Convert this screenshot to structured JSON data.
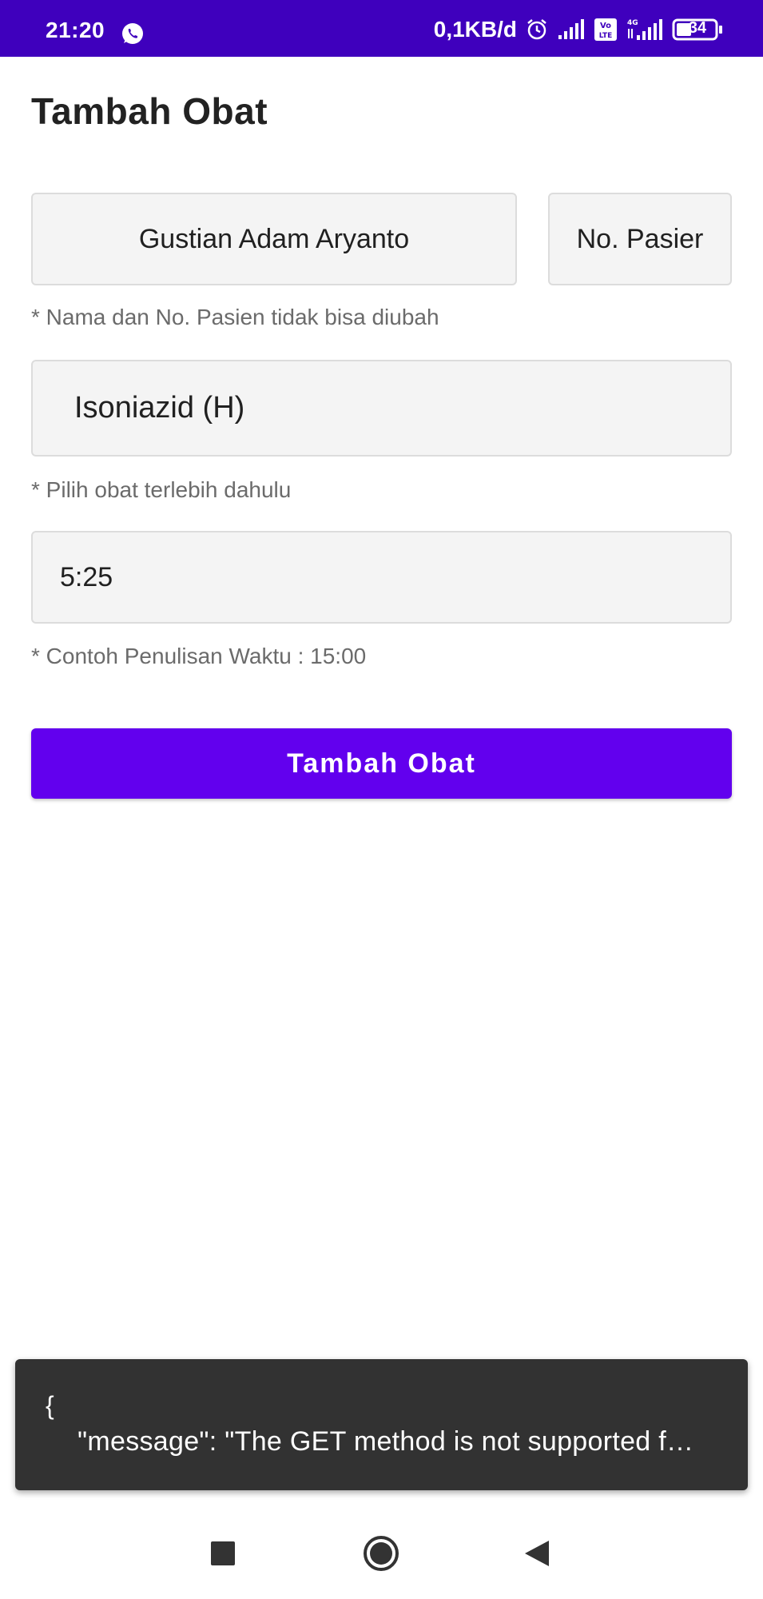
{
  "status_bar": {
    "time": "21:20",
    "network_speed": "0,1KB/d",
    "volte_label": "Vo LTE",
    "network_type": "4G",
    "battery": "34",
    "icons": [
      "whatsapp-icon",
      "alarm-icon",
      "signal-icon",
      "volte-icon",
      "signal-4g-icon",
      "battery-icon"
    ]
  },
  "screen": {
    "title": "Tambah Obat"
  },
  "form": {
    "patient_name": "Gustian Adam Aryanto",
    "patient_number": "No. Pasier",
    "patient_hint": "* Nama dan No. Pasien tidak bisa diubah",
    "medicine_selected": "Isoniazid (H)",
    "medicine_hint": "* Pilih obat terlebih dahulu",
    "time_value": "5:25",
    "time_hint": "* Contoh Penulisan Waktu : 15:00",
    "submit_label": "Tambah Obat"
  },
  "toast": {
    "line1": "{",
    "line2": "\"message\": \"The GET method is not supported f…"
  },
  "nav_bar": {
    "buttons": [
      "recents-icon",
      "home-icon",
      "back-icon"
    ]
  },
  "colors": {
    "status_bar": "#3f00bd",
    "primary": "#6200ee",
    "toast_bg": "#323232",
    "field_bg": "#f4f4f4"
  }
}
